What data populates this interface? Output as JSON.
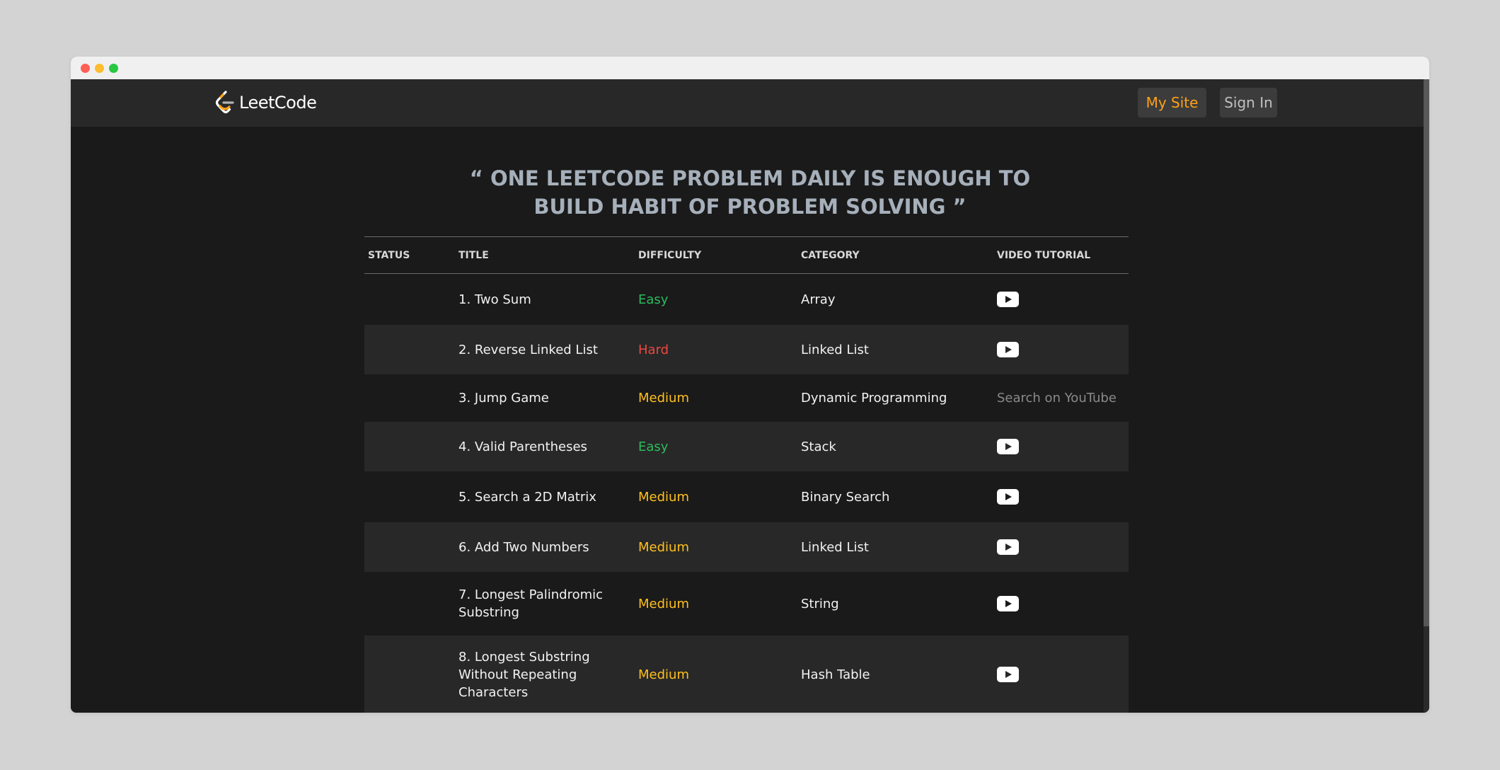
{
  "nav": {
    "logo_text": "LeetCode",
    "my_site_label": "My Site",
    "sign_in_label": "Sign In"
  },
  "quote": {
    "line1": "“ ONE LEETCODE PROBLEM DAILY IS ENOUGH TO",
    "line2": "BUILD HABIT OF PROBLEM SOLVING ”"
  },
  "table": {
    "headers": {
      "status": "STATUS",
      "title": "TITLE",
      "difficulty": "DIFFICULTY",
      "category": "CATEGORY",
      "video": "VIDEO TUTORIAL"
    },
    "rows": [
      {
        "title": "1. Two Sum",
        "difficulty": "Easy",
        "category": "Array",
        "video": "youtube-icon"
      },
      {
        "title": "2. Reverse Linked List",
        "difficulty": "Hard",
        "category": "Linked List",
        "video": "youtube-icon"
      },
      {
        "title": "3. Jump Game",
        "difficulty": "Medium",
        "category": "Dynamic Programming",
        "video_text": "Search on YouTube"
      },
      {
        "title": "4. Valid Parentheses",
        "difficulty": "Easy",
        "category": "Stack",
        "video": "youtube-icon"
      },
      {
        "title": "5. Search a 2D Matrix",
        "difficulty": "Medium",
        "category": "Binary Search",
        "video": "youtube-icon"
      },
      {
        "title": "6. Add Two Numbers",
        "difficulty": "Medium",
        "category": "Linked List",
        "video": "youtube-icon"
      },
      {
        "title": "7. Longest Palindromic Substring",
        "difficulty": "Medium",
        "category": "String",
        "video": "youtube-icon"
      },
      {
        "title": "8. Longest Substring Without Repeating Characters",
        "difficulty": "Medium",
        "category": "Hash Table",
        "video": "youtube-icon"
      }
    ]
  },
  "colors": {
    "easy": "#2cbb5d",
    "medium": "#ffc01e",
    "hard": "#ef4743",
    "accent": "#ffa116"
  }
}
